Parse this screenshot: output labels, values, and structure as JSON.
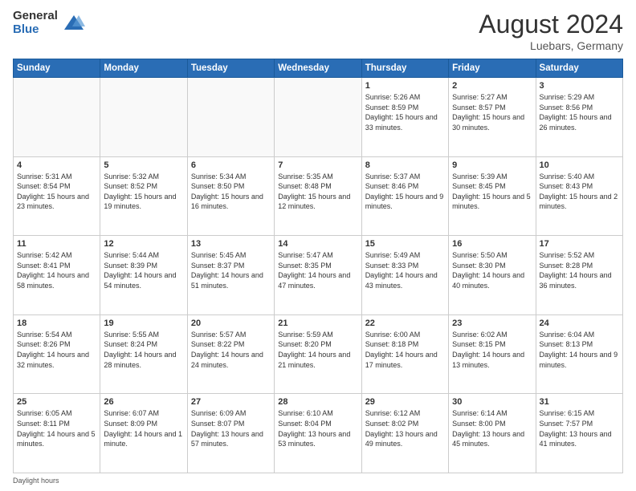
{
  "header": {
    "logo_general": "General",
    "logo_blue": "Blue",
    "month_year": "August 2024",
    "location": "Luebars, Germany"
  },
  "days_of_week": [
    "Sunday",
    "Monday",
    "Tuesday",
    "Wednesday",
    "Thursday",
    "Friday",
    "Saturday"
  ],
  "footer_text": "Daylight hours",
  "weeks": [
    [
      {
        "day": "",
        "info": ""
      },
      {
        "day": "",
        "info": ""
      },
      {
        "day": "",
        "info": ""
      },
      {
        "day": "",
        "info": ""
      },
      {
        "day": "1",
        "info": "Sunrise: 5:26 AM\nSunset: 8:59 PM\nDaylight: 15 hours\nand 33 minutes."
      },
      {
        "day": "2",
        "info": "Sunrise: 5:27 AM\nSunset: 8:57 PM\nDaylight: 15 hours\nand 30 minutes."
      },
      {
        "day": "3",
        "info": "Sunrise: 5:29 AM\nSunset: 8:56 PM\nDaylight: 15 hours\nand 26 minutes."
      }
    ],
    [
      {
        "day": "4",
        "info": "Sunrise: 5:31 AM\nSunset: 8:54 PM\nDaylight: 15 hours\nand 23 minutes."
      },
      {
        "day": "5",
        "info": "Sunrise: 5:32 AM\nSunset: 8:52 PM\nDaylight: 15 hours\nand 19 minutes."
      },
      {
        "day": "6",
        "info": "Sunrise: 5:34 AM\nSunset: 8:50 PM\nDaylight: 15 hours\nand 16 minutes."
      },
      {
        "day": "7",
        "info": "Sunrise: 5:35 AM\nSunset: 8:48 PM\nDaylight: 15 hours\nand 12 minutes."
      },
      {
        "day": "8",
        "info": "Sunrise: 5:37 AM\nSunset: 8:46 PM\nDaylight: 15 hours\nand 9 minutes."
      },
      {
        "day": "9",
        "info": "Sunrise: 5:39 AM\nSunset: 8:45 PM\nDaylight: 15 hours\nand 5 minutes."
      },
      {
        "day": "10",
        "info": "Sunrise: 5:40 AM\nSunset: 8:43 PM\nDaylight: 15 hours\nand 2 minutes."
      }
    ],
    [
      {
        "day": "11",
        "info": "Sunrise: 5:42 AM\nSunset: 8:41 PM\nDaylight: 14 hours\nand 58 minutes."
      },
      {
        "day": "12",
        "info": "Sunrise: 5:44 AM\nSunset: 8:39 PM\nDaylight: 14 hours\nand 54 minutes."
      },
      {
        "day": "13",
        "info": "Sunrise: 5:45 AM\nSunset: 8:37 PM\nDaylight: 14 hours\nand 51 minutes."
      },
      {
        "day": "14",
        "info": "Sunrise: 5:47 AM\nSunset: 8:35 PM\nDaylight: 14 hours\nand 47 minutes."
      },
      {
        "day": "15",
        "info": "Sunrise: 5:49 AM\nSunset: 8:33 PM\nDaylight: 14 hours\nand 43 minutes."
      },
      {
        "day": "16",
        "info": "Sunrise: 5:50 AM\nSunset: 8:30 PM\nDaylight: 14 hours\nand 40 minutes."
      },
      {
        "day": "17",
        "info": "Sunrise: 5:52 AM\nSunset: 8:28 PM\nDaylight: 14 hours\nand 36 minutes."
      }
    ],
    [
      {
        "day": "18",
        "info": "Sunrise: 5:54 AM\nSunset: 8:26 PM\nDaylight: 14 hours\nand 32 minutes."
      },
      {
        "day": "19",
        "info": "Sunrise: 5:55 AM\nSunset: 8:24 PM\nDaylight: 14 hours\nand 28 minutes."
      },
      {
        "day": "20",
        "info": "Sunrise: 5:57 AM\nSunset: 8:22 PM\nDaylight: 14 hours\nand 24 minutes."
      },
      {
        "day": "21",
        "info": "Sunrise: 5:59 AM\nSunset: 8:20 PM\nDaylight: 14 hours\nand 21 minutes."
      },
      {
        "day": "22",
        "info": "Sunrise: 6:00 AM\nSunset: 8:18 PM\nDaylight: 14 hours\nand 17 minutes."
      },
      {
        "day": "23",
        "info": "Sunrise: 6:02 AM\nSunset: 8:15 PM\nDaylight: 14 hours\nand 13 minutes."
      },
      {
        "day": "24",
        "info": "Sunrise: 6:04 AM\nSunset: 8:13 PM\nDaylight: 14 hours\nand 9 minutes."
      }
    ],
    [
      {
        "day": "25",
        "info": "Sunrise: 6:05 AM\nSunset: 8:11 PM\nDaylight: 14 hours\nand 5 minutes."
      },
      {
        "day": "26",
        "info": "Sunrise: 6:07 AM\nSunset: 8:09 PM\nDaylight: 14 hours\nand 1 minute."
      },
      {
        "day": "27",
        "info": "Sunrise: 6:09 AM\nSunset: 8:07 PM\nDaylight: 13 hours\nand 57 minutes."
      },
      {
        "day": "28",
        "info": "Sunrise: 6:10 AM\nSunset: 8:04 PM\nDaylight: 13 hours\nand 53 minutes."
      },
      {
        "day": "29",
        "info": "Sunrise: 6:12 AM\nSunset: 8:02 PM\nDaylight: 13 hours\nand 49 minutes."
      },
      {
        "day": "30",
        "info": "Sunrise: 6:14 AM\nSunset: 8:00 PM\nDaylight: 13 hours\nand 45 minutes."
      },
      {
        "day": "31",
        "info": "Sunrise: 6:15 AM\nSunset: 7:57 PM\nDaylight: 13 hours\nand 41 minutes."
      }
    ]
  ]
}
